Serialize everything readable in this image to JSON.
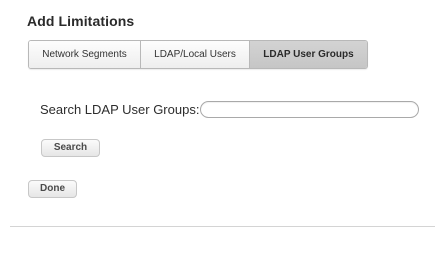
{
  "dialog": {
    "title": "Add Limitations"
  },
  "tabs": [
    {
      "label": "Network Segments",
      "active": false
    },
    {
      "label": "LDAP/Local Users",
      "active": false
    },
    {
      "label": "LDAP User Groups",
      "active": true
    }
  ],
  "search": {
    "label": "Search LDAP User Groups:",
    "value": "",
    "button_label": "Search"
  },
  "footer": {
    "done_label": "Done"
  },
  "colors": {
    "active_tab": "#c9c9c9",
    "divider": "#d4d4d4"
  }
}
